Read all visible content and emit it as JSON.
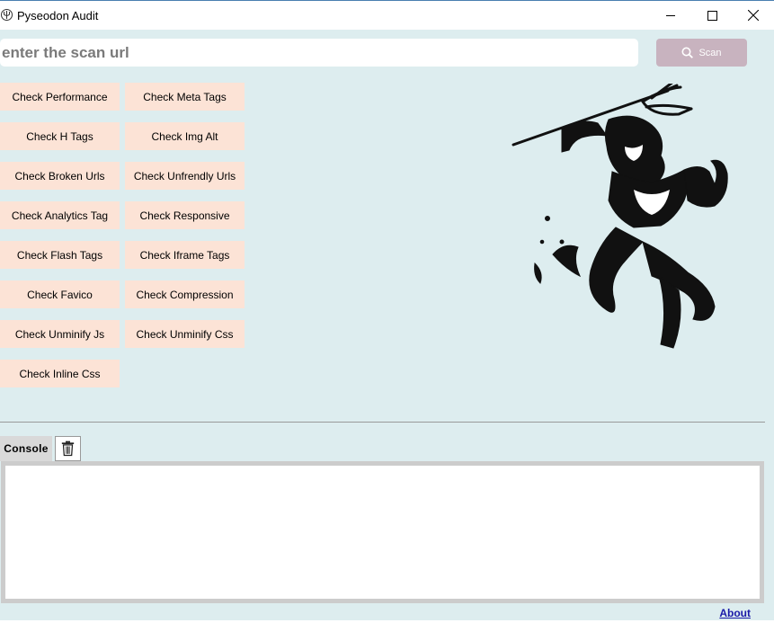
{
  "window": {
    "title": "Pyseodon Audit",
    "icon": "app-trident-icon",
    "controls": [
      "minimize-icon",
      "maximize-icon",
      "close-icon"
    ]
  },
  "search": {
    "placeholder": "enter the scan url",
    "value": ""
  },
  "scan_button": {
    "label": "Scan",
    "icon": "search-icon",
    "color": "#c8b3bf"
  },
  "checks": [
    "Check Performance",
    "Check Meta Tags",
    "Check H Tags",
    "Check Img Alt",
    "Check Broken Urls",
    "Check Unfrendly Urls",
    "Check Analytics Tag",
    "Check Responsive",
    "Check Flash Tags",
    "Check Iframe Tags",
    "Check Favico",
    "Check Compression",
    "Check Unminify Js",
    "Check Unminify Css",
    "Check Inline Css"
  ],
  "console": {
    "label": "Console",
    "clear_icon": "trash-icon",
    "output": ""
  },
  "footer": {
    "about": "About"
  },
  "colors": {
    "background": "#ddedef",
    "check_button": "#fce3d6",
    "link": "#1a1aa8"
  }
}
